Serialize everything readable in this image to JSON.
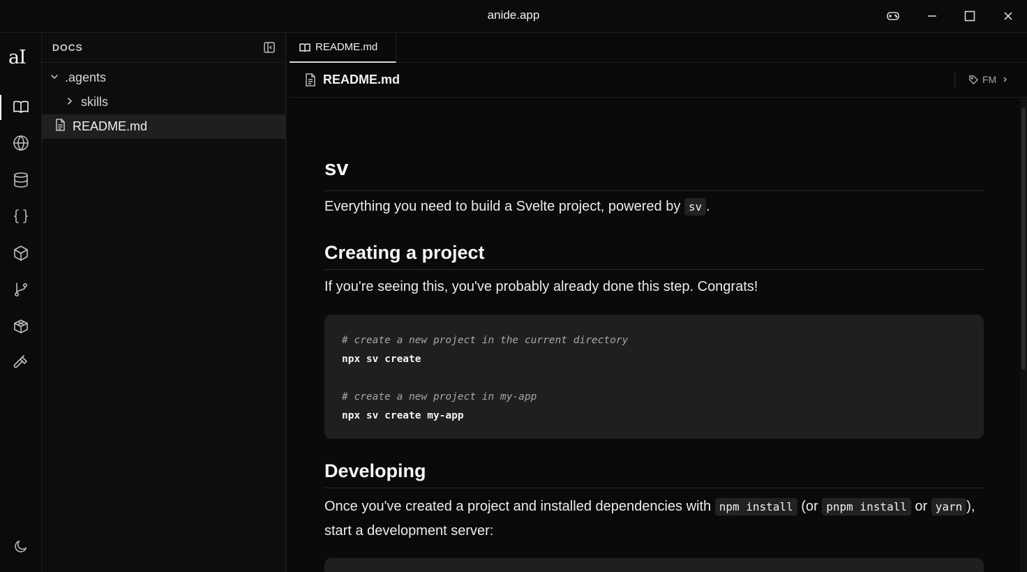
{
  "window": {
    "title": "anide.app"
  },
  "activity": {
    "logo": "aI"
  },
  "explorer": {
    "heading": "DOCS",
    "tree": [
      {
        "label": ".agents",
        "type": "folder",
        "expanded": true
      },
      {
        "label": "skills",
        "type": "folder",
        "expanded": false
      },
      {
        "label": "README.md",
        "type": "file",
        "selected": true
      }
    ]
  },
  "editor": {
    "tab_label": "README.md",
    "breadcrumb_file": "README.md",
    "fm_label": "FM",
    "doc": {
      "h1": "sv",
      "intro_text": "Everything you need to build a Svelte project, powered by ",
      "intro_code": "sv",
      "intro_end": ".",
      "h2_create": "Creating a project",
      "create_text": "If you're seeing this, you've probably already done this step. Congrats!",
      "code1": {
        "comment1": "# create a new project in the current directory",
        "cmd1": "npx sv create",
        "comment2": "# create a new project in my-app",
        "cmd2": "npx sv create my-app"
      },
      "h2_dev": "Developing",
      "dev_text_1": "Once you've created a project and installed dependencies with ",
      "dev_code_1": "npm install",
      "dev_text_2": " (or ",
      "dev_code_2": "pnpm install",
      "dev_text_3": " or ",
      "dev_code_3": "yarn",
      "dev_text_4": "), start a development server:"
    }
  }
}
